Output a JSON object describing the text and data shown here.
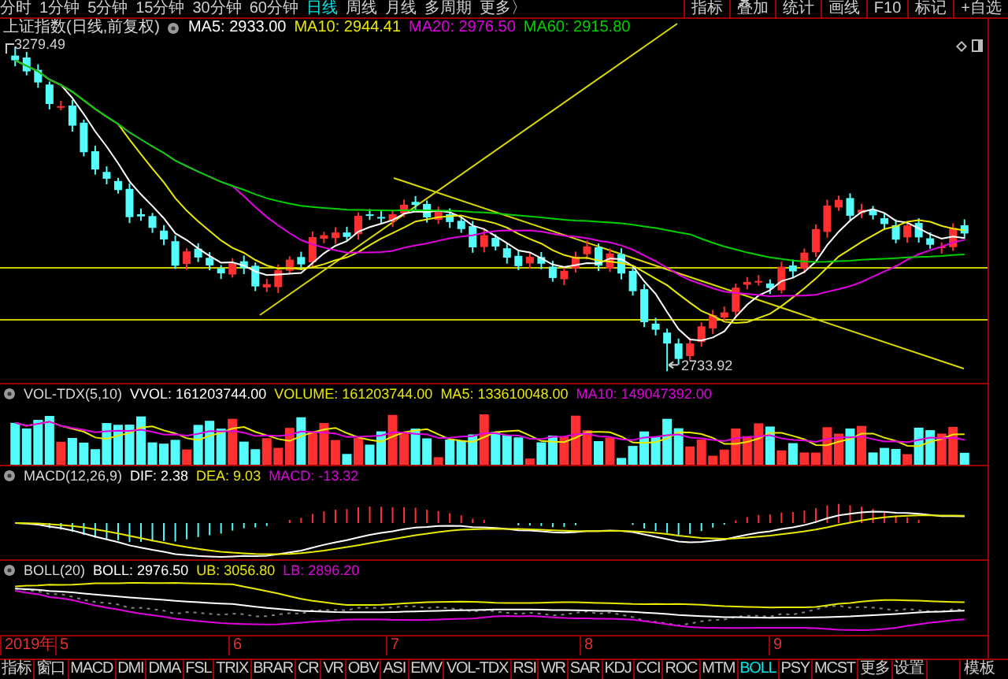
{
  "period_tabs": [
    {
      "label": "分时",
      "selected": false
    },
    {
      "label": "1分钟",
      "selected": false
    },
    {
      "label": "5分钟",
      "selected": false
    },
    {
      "label": "15分钟",
      "selected": false
    },
    {
      "label": "30分钟",
      "selected": false
    },
    {
      "label": "60分钟",
      "selected": false
    },
    {
      "label": "日线",
      "selected": true
    },
    {
      "label": "周线",
      "selected": false
    },
    {
      "label": "月线",
      "selected": false
    },
    {
      "label": "多周期",
      "selected": false
    },
    {
      "label": "更多〉",
      "selected": false
    }
  ],
  "toolbar_buttons": [
    "指标",
    "叠加",
    "统计",
    "画线",
    "F10",
    "标记",
    "+自选"
  ],
  "main_chart": {
    "title": "上证指数(日线,前复权)",
    "high_label": "3279.49",
    "low_label": "2733.92",
    "indicators": [
      {
        "label": "MA5: 2933.00",
        "color": "#ffffff"
      },
      {
        "label": "MA10: 2944.41",
        "color": "#e8e800"
      },
      {
        "label": "MA20: 2976.50",
        "color": "#e000e0"
      },
      {
        "label": "MA60: 2915.80",
        "color": "#00d000"
      }
    ]
  },
  "volume_panel": {
    "title": "VOL-TDX(5,10)",
    "indicators": [
      {
        "label": "VVOL: 161203744.00",
        "color": "#ffffff"
      },
      {
        "label": "VOLUME: 161203744.00",
        "color": "#e8e800"
      },
      {
        "label": "MA5: 133610048.00",
        "color": "#e8e800"
      },
      {
        "label": "MA10: 149047392.00",
        "color": "#e000e0"
      }
    ]
  },
  "macd_panel": {
    "title": "MACD(12,26,9)",
    "indicators": [
      {
        "label": "DIF: 2.38",
        "color": "#ffffff"
      },
      {
        "label": "DEA: 9.03",
        "color": "#e8e800"
      },
      {
        "label": "MACD: -13.32",
        "color": "#e000e0"
      }
    ]
  },
  "boll_panel": {
    "title": "BOLL(20)",
    "indicators": [
      {
        "label": "BOLL: 2976.50",
        "color": "#ffffff"
      },
      {
        "label": "UB: 3056.80",
        "color": "#e8e800"
      },
      {
        "label": "LB: 2896.20",
        "color": "#e000e0"
      }
    ]
  },
  "date_axis": [
    "2019年",
    "5",
    "6",
    "7",
    "8",
    "9"
  ],
  "indicator_tabs": [
    {
      "label": "指标",
      "selected": false
    },
    {
      "label": "窗口",
      "selected": false
    },
    {
      "label": "MACD",
      "selected": false
    },
    {
      "label": "DMI",
      "selected": false
    },
    {
      "label": "DMA",
      "selected": false
    },
    {
      "label": "FSL",
      "selected": false
    },
    {
      "label": "TRIX",
      "selected": false
    },
    {
      "label": "BRAR",
      "selected": false
    },
    {
      "label": "CR",
      "selected": false
    },
    {
      "label": "VR",
      "selected": false
    },
    {
      "label": "OBV",
      "selected": false
    },
    {
      "label": "ASI",
      "selected": false
    },
    {
      "label": "EMV",
      "selected": false
    },
    {
      "label": "VOL-TDX",
      "selected": false
    },
    {
      "label": "RSI",
      "selected": false
    },
    {
      "label": "WR",
      "selected": false
    },
    {
      "label": "SAR",
      "selected": false
    },
    {
      "label": "KDJ",
      "selected": false
    },
    {
      "label": "CCI",
      "selected": false
    },
    {
      "label": "ROC",
      "selected": false
    },
    {
      "label": "MTM",
      "selected": false
    },
    {
      "label": "BOLL",
      "selected": true
    },
    {
      "label": "PSY",
      "selected": false
    },
    {
      "label": "MCST",
      "selected": false
    },
    {
      "label": "更多",
      "selected": false
    },
    {
      "label": "设置",
      "selected": false
    }
  ],
  "template_button": "模板"
}
